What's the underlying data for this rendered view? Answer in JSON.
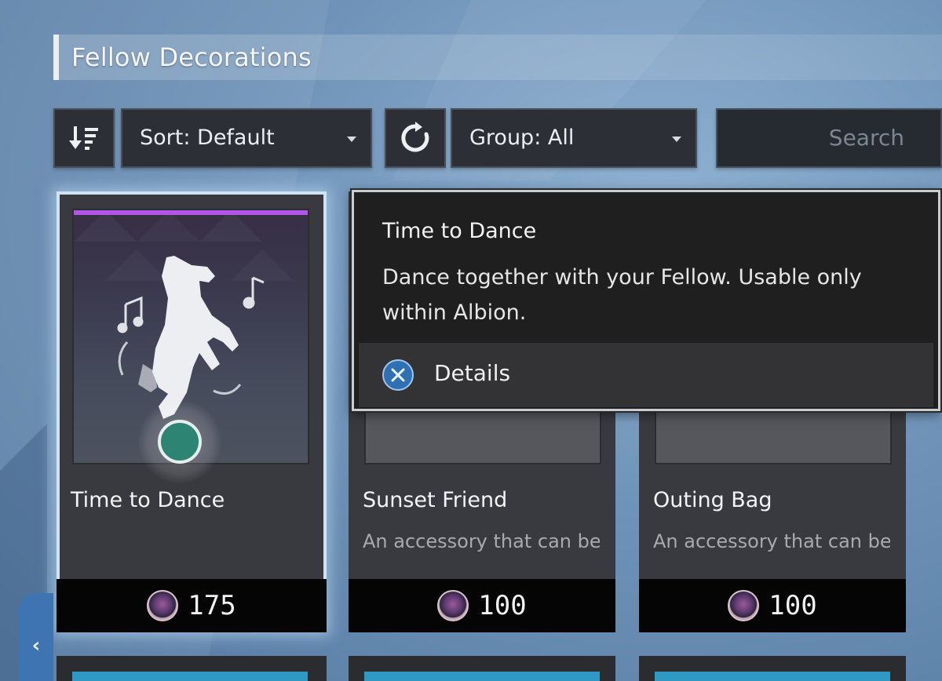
{
  "header": {
    "title": "Fellow Decorations"
  },
  "toolbar": {
    "sort_label": "Sort: Default",
    "group_label": "Group: All",
    "search_placeholder": "Search"
  },
  "cards": [
    {
      "name": "Time to Dance",
      "description": "",
      "price": "175",
      "selected": true
    },
    {
      "name": "Sunset Friend",
      "description": "An accessory that can be",
      "price": "100"
    },
    {
      "name": "Outing Bag",
      "description": "An accessory that can be",
      "price": "100"
    }
  ],
  "tooltip": {
    "title": "Time to Dance",
    "description": "Dance together with your Fellow. Usable only within Albion.",
    "action_label": "Details"
  },
  "colors": {
    "card_bg": "#393a3f",
    "rarity_purple": "#b157e6",
    "tooltip_bg": "#1f1f20",
    "cursor_green": "#2e8473",
    "button_blue": "#2f6fb4"
  },
  "icons": [
    "sort-icon",
    "refresh-icon",
    "dropdown-caret-icon",
    "coin-icon",
    "cross-button-icon",
    "chevron-left-icon",
    "dancing-dog-icon",
    "music-note-icon"
  ]
}
